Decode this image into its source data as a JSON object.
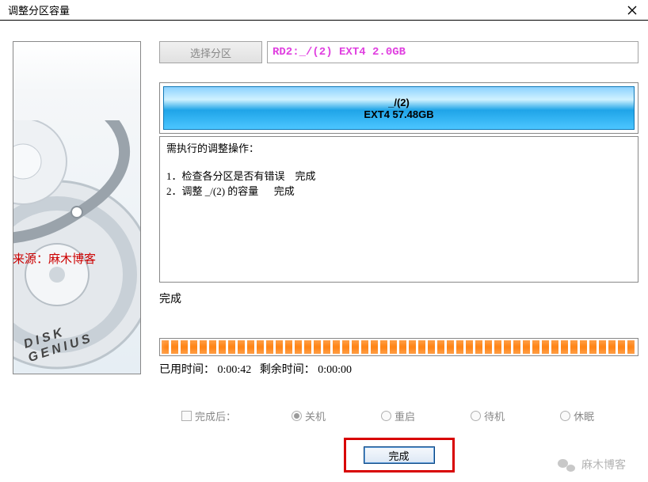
{
  "window": {
    "title": "调整分区容量"
  },
  "watermark_left": "来源：麻木博客",
  "watermark_right": "麻木博客",
  "logo_text": "DISK GENIUS",
  "toolbar": {
    "select_label": "选择分区",
    "path": "RD2:_/(2) EXT4 2.0GB"
  },
  "partition": {
    "name": "_/(2)",
    "line2": "EXT4 57.48GB"
  },
  "log": {
    "header": "需执行的调整操作：",
    "lines": [
      "1．检查各分区是否有错误    完成",
      "2．调整 _/(2) 的容量      完成"
    ]
  },
  "status": "完成",
  "progress_percent": 100,
  "time": {
    "elapsed_label": "已用时间：",
    "elapsed": "0:00:42",
    "remaining_label": "剩余时间：",
    "remaining": "0:00:00"
  },
  "options": {
    "after_label": "完成后：",
    "items": [
      {
        "key": "shutdown",
        "label": "关机",
        "selected": true
      },
      {
        "key": "restart",
        "label": "重启",
        "selected": false
      },
      {
        "key": "standby",
        "label": "待机",
        "selected": false
      },
      {
        "key": "hibernate",
        "label": "休眠",
        "selected": false
      }
    ]
  },
  "buttons": {
    "done": "完成"
  }
}
